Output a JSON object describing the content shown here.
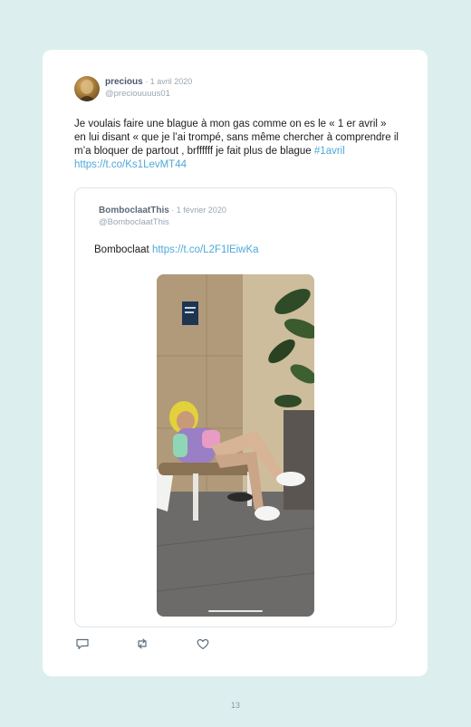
{
  "tweet": {
    "author_name": "precious",
    "date": " · 1 avril 2020",
    "handle": "@preciouuuus01",
    "text": "Je voulais faire une blague à mon gas comme on es le « 1 er avril » en lui disant «  que je l’ai trompé, sans même chercher à comprendre il m’a bloquer de partout , brffffff je fait plus de blague ",
    "hashtag": "#1avril",
    "link": "https://t.co/Ks1LevMT44"
  },
  "quoted": {
    "author_name": "BomboclaatThis",
    "date": " · 1 février 2020",
    "handle": "@BomboclaatThis",
    "text": "Bomboclaat ",
    "link": "https://t.co/L2F1lEiwKa"
  },
  "actions": {
    "reply_icon": "reply-icon",
    "retweet_icon": "retweet-icon",
    "like_icon": "heart-icon"
  },
  "page": {
    "number": "13"
  },
  "colors": {
    "background": "#dcefee",
    "card": "#ffffff",
    "link": "#4fa8d8"
  }
}
